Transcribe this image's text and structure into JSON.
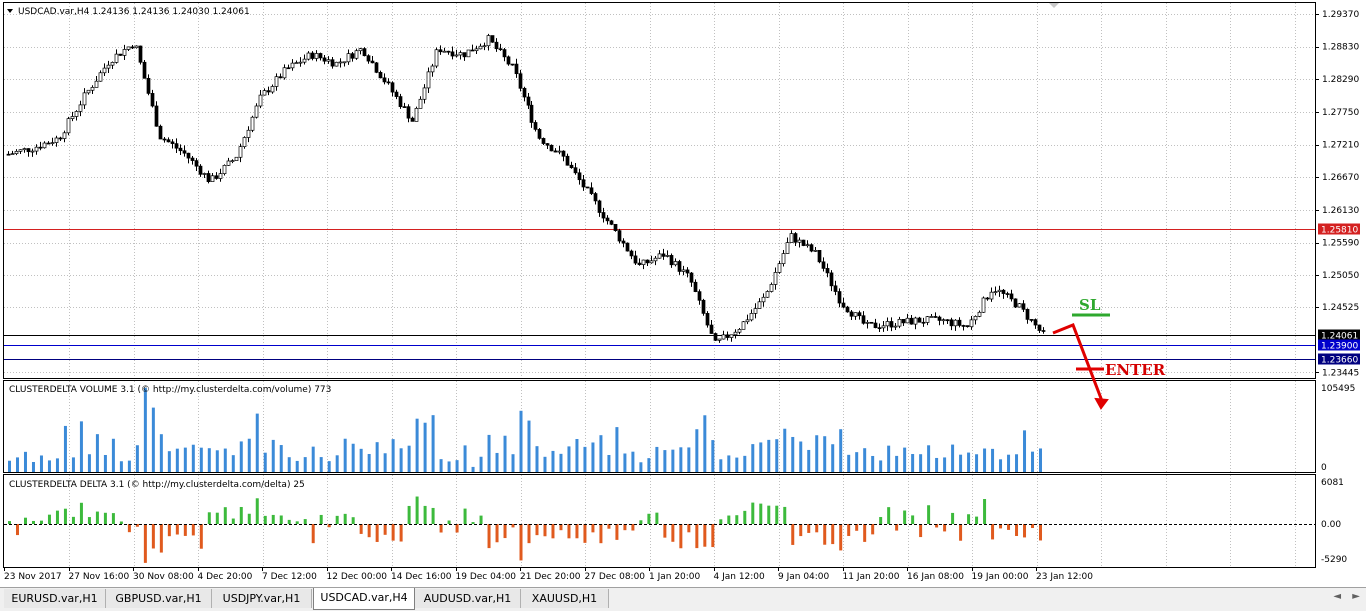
{
  "chart": {
    "symbol_line": "USDCAD.var,H4  1.24136 1.24136 1.24030 1.24061",
    "price_scale": [
      "1.29370",
      "1.28830",
      "1.28290",
      "1.27750",
      "1.27210",
      "1.26670",
      "1.26130",
      "1.25590",
      "1.25050",
      "1.24525",
      "1.23445"
    ],
    "horizontal_lines": [
      {
        "price": 1.2581,
        "label": "1.25810",
        "color": "#d42020"
      },
      {
        "price": 1.2406,
        "label": "1.24061",
        "color": "#000000"
      },
      {
        "price": 1.239,
        "label": "1.23900",
        "color": "#0000cc"
      },
      {
        "price": 1.2366,
        "label": "1.23660",
        "color": "#000080"
      }
    ],
    "annotations": {
      "sl": "SL",
      "enter": "ENTER"
    }
  },
  "volume_panel": {
    "title": "CLUSTERDELTA VOLUME 3.1 (© http://my.clusterdelta.com/volume) 773",
    "max_label": "105495",
    "min_label": "0"
  },
  "delta_panel": {
    "title": "CLUSTERDELTA DELTA 3.1 (© http://my.clusterdelta.com/delta) 25",
    "max_label": "6081",
    "zero_label": "0.00",
    "min_label": "-5290"
  },
  "time_axis": [
    "23 Nov 2017",
    "27 Nov 16:00",
    "30 Nov 08:00",
    "4 Dec 20:00",
    "7 Dec 12:00",
    "12 Dec 00:00",
    "14 Dec 16:00",
    "19 Dec 04:00",
    "21 Dec 20:00",
    "27 Dec 08:00",
    "1 Jan 20:00",
    "4 Jan 12:00",
    "9 Jan 04:00",
    "11 Jan 20:00",
    "16 Jan 08:00",
    "19 Jan 00:00",
    "23 Jan 12:00"
  ],
  "tabs": [
    {
      "label": "EURUSD.var,H1",
      "active": false
    },
    {
      "label": "GBPUSD.var,H1",
      "active": false
    },
    {
      "label": "USDJPY.var,H1",
      "active": false
    },
    {
      "label": "USDCAD.var,H4",
      "active": true
    },
    {
      "label": "AUDUSD.var,H1",
      "active": false
    },
    {
      "label": "XAUUSD,H1",
      "active": false
    }
  ],
  "tab_nav": {
    "left": "◄",
    "right": "►"
  },
  "chart_data": {
    "type": "candlestick",
    "symbol": "USDCAD",
    "timeframe": "H4",
    "ohlc": {
      "open": 1.24136,
      "high": 1.24136,
      "low": 1.2403,
      "close": 1.24061
    },
    "ylim": [
      1.2335,
      1.2955
    ],
    "y_ticks": [
      1.2937,
      1.2883,
      1.2829,
      1.2775,
      1.2721,
      1.2667,
      1.2613,
      1.2559,
      1.2505,
      1.24525,
      1.23445
    ],
    "close_path": [
      {
        "x": "23 Nov 2017",
        "y": 1.2705
      },
      {
        "x": "24 Nov",
        "y": 1.2716
      },
      {
        "x": "27 Nov 16:00",
        "y": 1.2732
      },
      {
        "x": "28 Nov",
        "y": 1.28
      },
      {
        "x": "29 Nov",
        "y": 1.286
      },
      {
        "x": "30 Nov 08:00",
        "y": 1.289
      },
      {
        "x": "30 Nov 16:00",
        "y": 1.2735
      },
      {
        "x": "1 Dec",
        "y": 1.2705
      },
      {
        "x": "4 Dec 20:00",
        "y": 1.266
      },
      {
        "x": "5 Dec",
        "y": 1.27
      },
      {
        "x": "6 Dec",
        "y": 1.28
      },
      {
        "x": "7 Dec 12:00",
        "y": 1.2845
      },
      {
        "x": "8 Dec",
        "y": 1.287
      },
      {
        "x": "11 Dec",
        "y": 1.2855
      },
      {
        "x": "12 Dec 00:00",
        "y": 1.288
      },
      {
        "x": "13 Dec",
        "y": 1.282
      },
      {
        "x": "14 Dec 16:00",
        "y": 1.276
      },
      {
        "x": "15 Dec",
        "y": 1.288
      },
      {
        "x": "18 Dec",
        "y": 1.287
      },
      {
        "x": "19 Dec 04:00",
        "y": 1.2895
      },
      {
        "x": "20 Dec",
        "y": 1.2845
      },
      {
        "x": "21 Dec 20:00",
        "y": 1.2735
      },
      {
        "x": "22 Dec",
        "y": 1.27
      },
      {
        "x": "27 Dec 08:00",
        "y": 1.264
      },
      {
        "x": "28 Dec",
        "y": 1.258
      },
      {
        "x": "1 Jan 20:00",
        "y": 1.252
      },
      {
        "x": "2 Jan",
        "y": 1.254
      },
      {
        "x": "3 Jan",
        "y": 1.25
      },
      {
        "x": "4 Jan 12:00",
        "y": 1.239
      },
      {
        "x": "5 Jan",
        "y": 1.242
      },
      {
        "x": "8 Jan",
        "y": 1.247
      },
      {
        "x": "9 Jan 04:00",
        "y": 1.257
      },
      {
        "x": "10 Jan",
        "y": 1.254
      },
      {
        "x": "11 Jan 20:00",
        "y": 1.246
      },
      {
        "x": "12 Jan",
        "y": 1.242
      },
      {
        "x": "15 Jan",
        "y": 1.2425
      },
      {
        "x": "16 Jan 08:00",
        "y": 1.243
      },
      {
        "x": "17 Jan",
        "y": 1.243
      },
      {
        "x": "18 Jan",
        "y": 1.242
      },
      {
        "x": "19 Jan 00:00",
        "y": 1.2485
      },
      {
        "x": "22 Jan",
        "y": 1.2455
      },
      {
        "x": "23 Jan 12:00",
        "y": 1.2406
      }
    ],
    "levels": {
      "sl": 1.2581,
      "current": 1.24061,
      "entry": 1.239,
      "target": 1.2366
    },
    "volume": {
      "max": 105495,
      "min": 0
    },
    "delta": {
      "max": 6081,
      "min": -5290
    }
  }
}
